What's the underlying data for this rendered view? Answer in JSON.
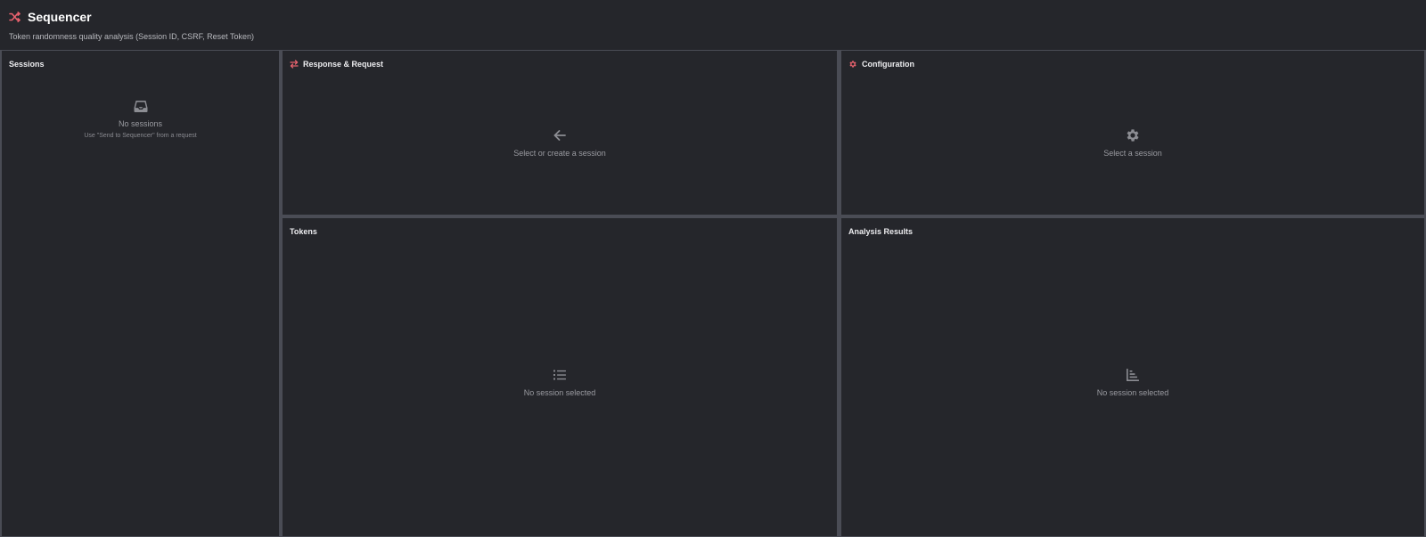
{
  "app": {
    "title": "Sequencer",
    "title_icon": "shuffle-icon",
    "subtitle": "Token randomness quality analysis (Session ID, CSRF, Reset Token)",
    "accent_color": "#e8626e"
  },
  "panels": {
    "sessions": {
      "title": "Sessions",
      "empty_icon": "inbox-icon",
      "empty_text": "No sessions",
      "empty_hint": "Use \"Send to Sequencer\" from a request"
    },
    "response_request": {
      "title": "Response & Request",
      "title_icon": "swap-icon",
      "empty_icon": "arrow-left-icon",
      "empty_text": "Select or create a session"
    },
    "configuration": {
      "title": "Configuration",
      "title_icon": "gear-icon",
      "empty_icon": "gear-icon",
      "empty_text": "Select a session"
    },
    "tokens": {
      "title": "Tokens",
      "empty_icon": "list-icon",
      "empty_text": "No session selected"
    },
    "analysis": {
      "title": "Analysis Results",
      "empty_icon": "bar-chart-icon",
      "empty_text": "No session selected"
    }
  }
}
